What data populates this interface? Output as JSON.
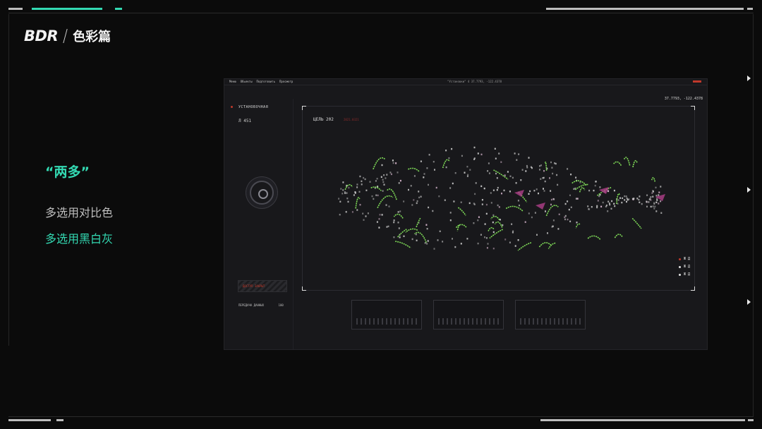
{
  "brand": {
    "logo": "BDR",
    "title": "色彩篇"
  },
  "content": {
    "heading": "“两多”",
    "point_1": "多选用对比色",
    "point_2": "多选用黑白灰"
  },
  "colors": {
    "accent": "#33d9b2",
    "background": "#0b0b0b",
    "map_green": "#7ed957",
    "map_magenta": "#b0408a",
    "alert_red": "#c0392b"
  },
  "dashboard": {
    "menu": [
      "Меню",
      "Обьекты",
      "Подготовить",
      "Просмотр"
    ],
    "center_title": "\"Установки\" 4 37.7793, -122.4378",
    "coords": "37.7793, -122.4378",
    "left_panel": {
      "title": "УСТАНОВОЧНАЯ",
      "unit": "Л 451",
      "warning": "ДОСТУП ЗАКРЫТ",
      "transfer": "ПЕРЕДАЧА ДАННЫХ",
      "transfer_value": "100"
    },
    "map": {
      "target": "ЦЕЛЬ 202",
      "target_sub": "2021.0321",
      "legend": [
        "Ж Д",
        "Ж Д",
        "Ж Д"
      ]
    }
  }
}
